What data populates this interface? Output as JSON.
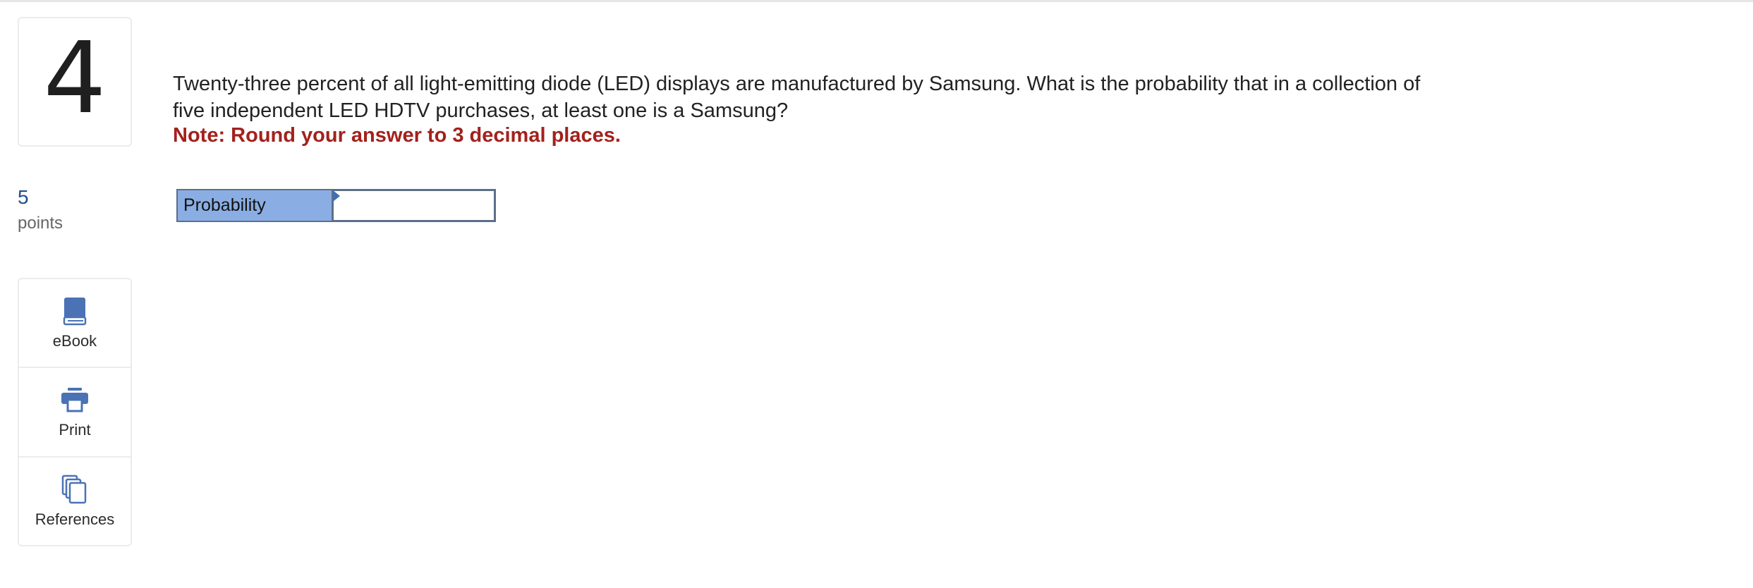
{
  "question": {
    "number": "4",
    "points_value": "5",
    "points_label": "points",
    "text": "Twenty-three percent of all light-emitting diode (LED) displays are manufactured by Samsung. What is the probability that in a collection of five independent LED HDTV purchases, at least one is a Samsung?",
    "note": "Note: Round your answer to 3 decimal places."
  },
  "answer": {
    "label": "Probability",
    "value": "",
    "placeholder": ""
  },
  "tools": [
    {
      "label": "eBook",
      "icon": "book-icon"
    },
    {
      "label": "Print",
      "icon": "printer-icon"
    },
    {
      "label": "References",
      "icon": "references-icon"
    }
  ],
  "colors": {
    "accent": "#3f6fb6",
    "points": "#1f4e8c",
    "note": "#a3211c",
    "label_bg": "#8aaee3",
    "border": "#5b6f8a"
  }
}
